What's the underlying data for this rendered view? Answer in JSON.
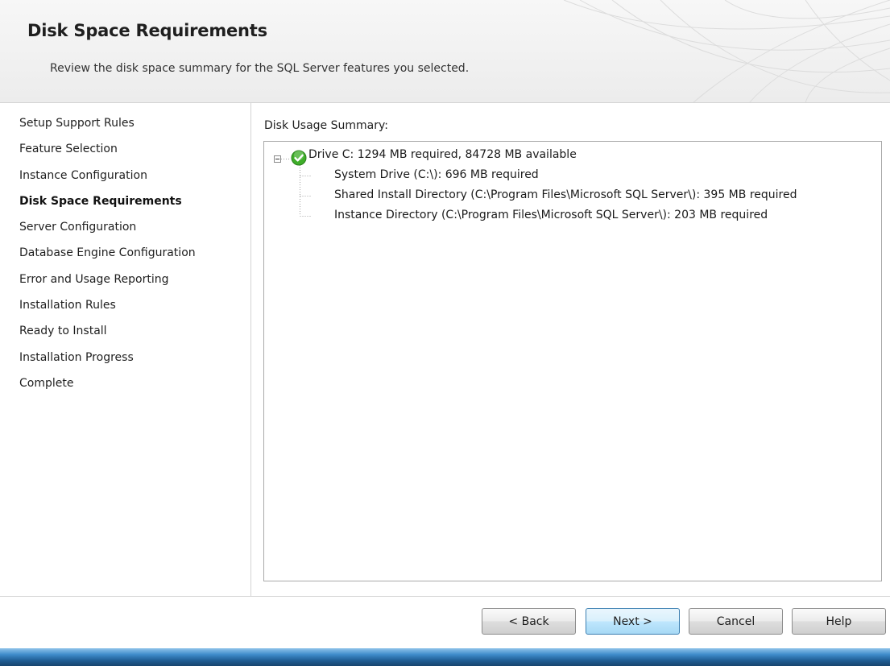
{
  "header": {
    "title": "Disk Space Requirements",
    "subtitle": "Review the disk space summary for the SQL Server features you selected."
  },
  "nav": {
    "items": [
      {
        "label": "Setup Support Rules",
        "active": false
      },
      {
        "label": "Feature Selection",
        "active": false
      },
      {
        "label": "Instance Configuration",
        "active": false
      },
      {
        "label": "Disk Space Requirements",
        "active": true
      },
      {
        "label": "Server Configuration",
        "active": false
      },
      {
        "label": "Database Engine Configuration",
        "active": false
      },
      {
        "label": "Error and Usage Reporting",
        "active": false
      },
      {
        "label": "Installation Rules",
        "active": false
      },
      {
        "label": "Ready to Install",
        "active": false
      },
      {
        "label": "Installation Progress",
        "active": false
      },
      {
        "label": "Complete",
        "active": false
      }
    ]
  },
  "summary": {
    "label": "Disk Usage Summary:",
    "tree": {
      "root": {
        "label": "Drive C: 1294 MB required, 84728 MB available",
        "icon": "check-circle-icon",
        "status_color": "#3fae2a"
      },
      "children": [
        "System Drive (C:\\): 696 MB required",
        "Shared Install Directory (C:\\Program Files\\Microsoft SQL Server\\): 395 MB required",
        "Instance Directory (C:\\Program Files\\Microsoft SQL Server\\): 203 MB required"
      ]
    }
  },
  "buttons": {
    "back": "< Back",
    "next": "Next >",
    "cancel": "Cancel",
    "help": "Help"
  }
}
